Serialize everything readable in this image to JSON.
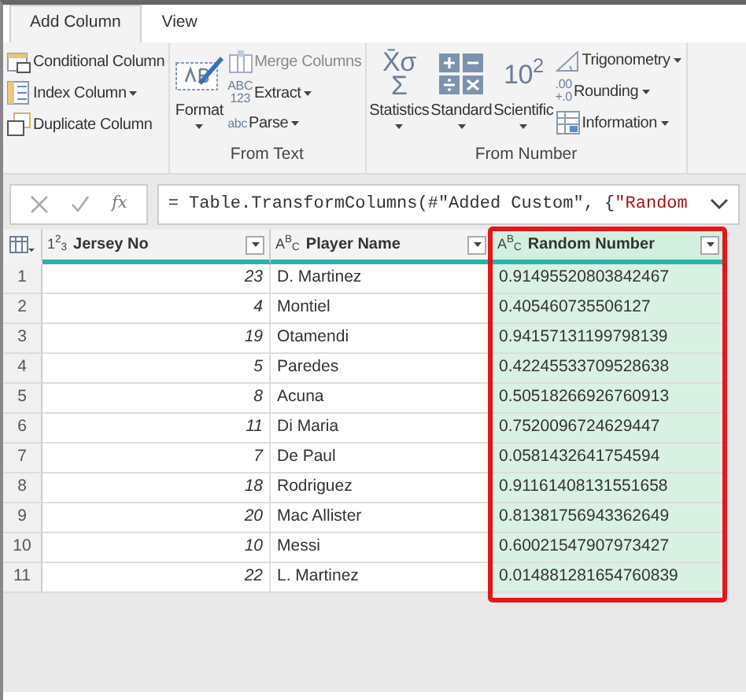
{
  "tabs": [
    {
      "label": "Add Column",
      "selected": true
    },
    {
      "label": "View",
      "selected": false
    }
  ],
  "ribbon_groups": [
    {
      "items": [
        {
          "kind": "small",
          "label": "Conditional Column",
          "has_menu": false,
          "disabled": false
        },
        {
          "kind": "small",
          "label": "Index Column",
          "has_menu": true,
          "disabled": false
        },
        {
          "kind": "small",
          "label": "Duplicate Column",
          "has_menu": false,
          "disabled": false
        }
      ]
    },
    {
      "title": "From Text",
      "items": [
        {
          "kind": "large",
          "label": "Format",
          "has_menu": true,
          "disabled": false
        },
        {
          "kind": "small",
          "label": "Merge Columns",
          "has_menu": false,
          "disabled": true
        },
        {
          "kind": "small",
          "glyph": "ABC\n123",
          "label": "Extract",
          "has_menu": true,
          "disabled": false
        },
        {
          "kind": "small",
          "glyph": "abc",
          "label": "Parse",
          "has_menu": true,
          "disabled": false
        }
      ]
    },
    {
      "title": "From Number",
      "items": [
        {
          "kind": "large",
          "glyph": "X̄σ\nΣ",
          "label": "Statistics",
          "has_menu": true,
          "disabled": false
        },
        {
          "kind": "large",
          "label": "Standard",
          "has_menu": true,
          "disabled": false
        },
        {
          "kind": "large",
          "glyph": "10$^{2}$",
          "label": "Scientific",
          "has_menu": true,
          "disabled": false
        },
        {
          "kind": "small",
          "label": "Trigonometry",
          "has_menu": true,
          "disabled": false
        },
        {
          "kind": "small",
          "glyph": ".00\n+.0",
          "label": "Rounding",
          "has_menu": true,
          "disabled": false
        },
        {
          "kind": "small",
          "label": "Information",
          "has_menu": true,
          "disabled": false
        }
      ]
    }
  ],
  "formula_bar": {
    "fx": "fx",
    "segments": [
      {
        "kind": "code",
        "text": "= Table.TransformColumns(#\"Added Custom\", {"
      },
      {
        "kind": "string",
        "text": "\"Random"
      }
    ]
  },
  "table": {
    "columns": [
      {
        "type": "1$^{2}$$_{3}$",
        "label": "Jersey No",
        "kind": "number",
        "selected": false
      },
      {
        "type": "A$^{B}$$_{C}$",
        "label": "Player Name",
        "kind": "text",
        "selected": false
      },
      {
        "type": "A$^{B}$$_{C}$",
        "label": "Random Number",
        "kind": "text",
        "selected": true
      }
    ],
    "rows": [
      {
        "index": "1",
        "cells": [
          "23",
          "D. Martinez",
          "0.91495520803842467"
        ]
      },
      {
        "index": "2",
        "cells": [
          "4",
          "Montiel",
          "0.405460735506127"
        ]
      },
      {
        "index": "3",
        "cells": [
          "19",
          "Otamendi",
          "0.94157131199798139"
        ]
      },
      {
        "index": "4",
        "cells": [
          "5",
          "Paredes",
          "0.42245533709528638"
        ]
      },
      {
        "index": "5",
        "cells": [
          "8",
          "Acuna",
          "0.50518266926760913"
        ]
      },
      {
        "index": "6",
        "cells": [
          "11",
          "Di Maria",
          "0.7520096724629447"
        ]
      },
      {
        "index": "7",
        "cells": [
          "7",
          "De Paul",
          "0.0581432641754594"
        ]
      },
      {
        "index": "8",
        "cells": [
          "18",
          "Rodriguez",
          "0.91161408131551658"
        ]
      },
      {
        "index": "9",
        "cells": [
          "20",
          "Mac Allister",
          "0.81381756943362649"
        ]
      },
      {
        "index": "10",
        "cells": [
          "10",
          "Messi",
          "0.60021547907973427"
        ]
      },
      {
        "index": "11",
        "cells": [
          "22",
          "L. Martinez",
          "0.014881281654760839"
        ]
      }
    ]
  }
}
